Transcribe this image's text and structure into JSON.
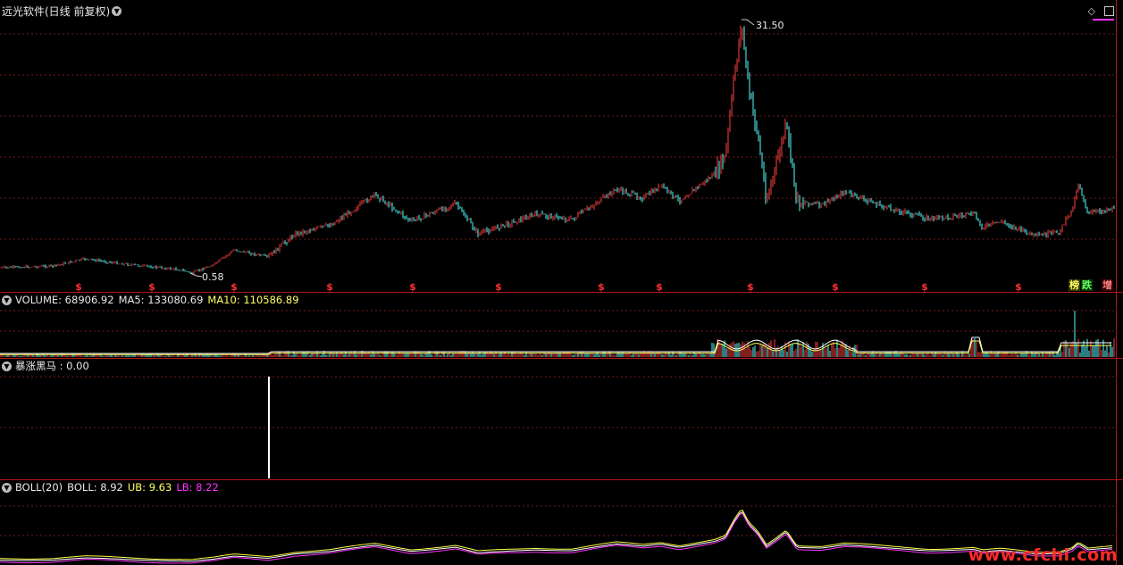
{
  "main": {
    "title": "远光软件(日线 前复权)",
    "high_label": "31.50",
    "low_label": "0.58",
    "tags": {
      "left": "榜",
      "mid": "跌",
      "right": "增"
    },
    "icons": [
      "diamond-icon",
      "panel-icon"
    ]
  },
  "volume": {
    "label": "VOLUME: 68906.92",
    "ma5": "MA5: 133080.69",
    "ma10": "MA10: 110586.89"
  },
  "indicator": {
    "label": "暴涨黑马 : 0.00"
  },
  "boll": {
    "label": "BOLL(20)",
    "boll": "BOLL: 8.92",
    "ub": "UB: 9.63",
    "lb": "LB: 8.22"
  },
  "watermark": "www.cfchi.com",
  "colors": {
    "price_up": "#ff4040",
    "price_down": "#54ffff",
    "grid": "#7a1a1a",
    "border": "#b01818",
    "volume_ma5": "#ffffff",
    "volume_ma10": "#ffff55",
    "boll_mid": "#ffffff",
    "boll_ub": "#ffff44",
    "boll_lb": "#ff33ff"
  }
}
